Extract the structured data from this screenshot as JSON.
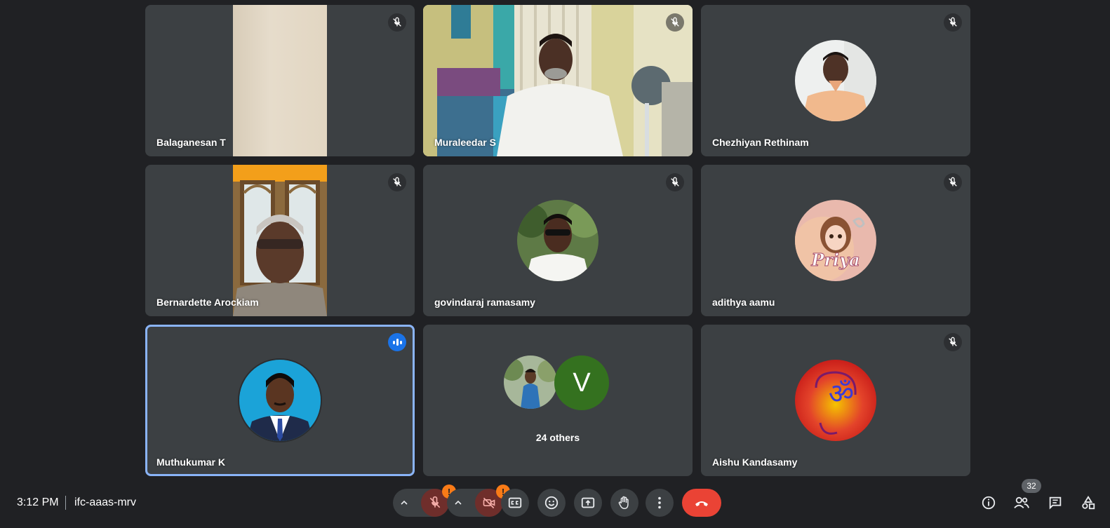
{
  "participants": [
    {
      "name": "Balaganesan T",
      "muted": true
    },
    {
      "name": "Muraleedar S",
      "muted": true
    },
    {
      "name": "Chezhiyan Rethinam",
      "muted": true
    },
    {
      "name": "Bernardette Arockiam",
      "muted": true
    },
    {
      "name": "govindaraj ramasamy",
      "muted": true
    },
    {
      "name": "adithya aamu",
      "muted": true
    },
    {
      "name": "Muthukumar K",
      "speaking": true
    },
    {
      "name": "Aishu Kandasamy",
      "muted": true
    }
  ],
  "others_tile": {
    "label": "24 others",
    "avatar_letter": "V",
    "avatar_letter_color": "#34711f"
  },
  "avatar_texts": {
    "priya": "Priya",
    "om": "ॐ"
  },
  "meeting": {
    "time": "3:12 PM",
    "code": "ifc-aaas-mrv"
  },
  "controls": {
    "alert_badge": "!",
    "people_count": "32"
  },
  "colors": {
    "background": "#202124",
    "tile": "#3c4043",
    "active_outline": "#8ab4f8",
    "end_call": "#ea4335",
    "alert": "#fa7b17"
  }
}
